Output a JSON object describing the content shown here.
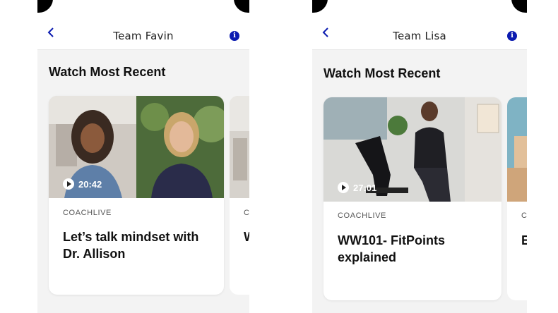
{
  "screens": [
    {
      "header": {
        "title": "Team Favin"
      },
      "section_title": "Watch Most Recent",
      "card": {
        "duration": "20:42",
        "kicker": "COACHLIVE",
        "title": "Let’s talk mindset with Dr. Allison"
      },
      "peek": {
        "kicker": "CO",
        "title": "W s"
      }
    },
    {
      "header": {
        "title": "Team Lisa"
      },
      "section_title": "Watch Most Recent",
      "card": {
        "duration": "27:01",
        "kicker": "COACHLIVE",
        "title": "WW101- FitPoints explained"
      },
      "peek": {
        "kicker": "C",
        "title": "E h"
      }
    }
  ],
  "colors": {
    "accent": "#0b1bb0",
    "background": "#f3f3f3"
  }
}
